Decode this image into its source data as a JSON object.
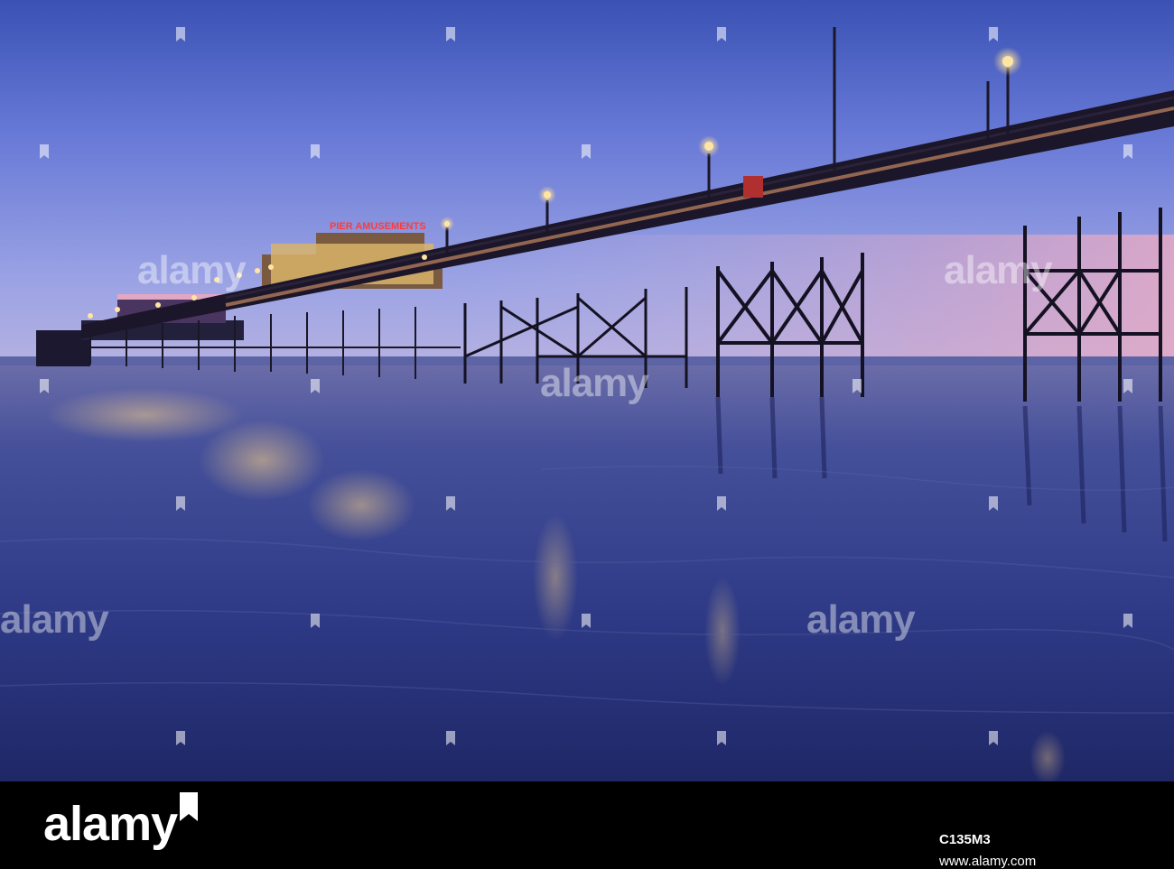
{
  "scene": {
    "description_alt": "Seaside pier at dusk reflected on wet sand",
    "sign_text": "PIER AMUSEMENTS"
  },
  "watermark": {
    "text": "alamy"
  },
  "footer": {
    "logo": "alamy",
    "image_id": "C135M3",
    "url": "www.alamy.com"
  },
  "colors": {
    "sky_top": "#3a52b4",
    "sky_mid": "#7f8fe2",
    "sky_horizon": "#d7a6c8",
    "sand": "#2a3478",
    "pier": "#141222",
    "lamp": "#ffe6a0"
  }
}
